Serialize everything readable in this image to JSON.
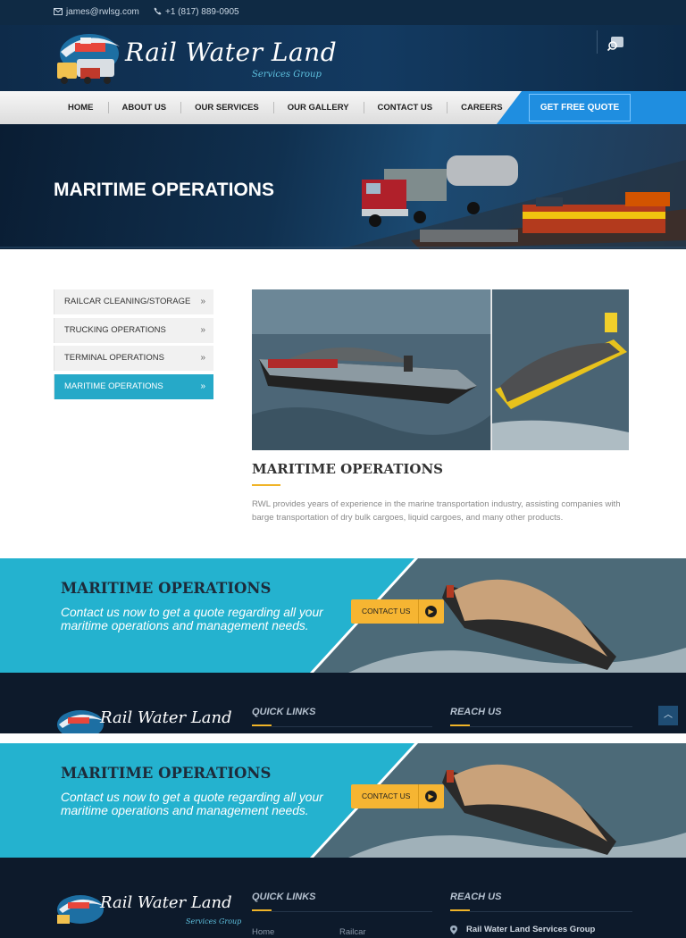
{
  "topbar": {
    "email": "james@rwlsg.com",
    "phone": "+1 (817) 889-0905"
  },
  "brand": {
    "name": "Rail Water Land",
    "tagline": "Services Group"
  },
  "nav": {
    "items": [
      "HOME",
      "ABOUT US",
      "OUR SERVICES",
      "OUR GALLERY",
      "CONTACT US",
      "CAREERS"
    ],
    "cta": "GET FREE QUOTE"
  },
  "banner": {
    "title": "MARITIME OPERATIONS"
  },
  "sidebar": {
    "items": [
      {
        "label": "RAILCAR CLEANING/STORAGE",
        "arrow": "»"
      },
      {
        "label": "TRUCKING OPERATIONS",
        "arrow": "»"
      },
      {
        "label": "TERMINAL OPERATIONS",
        "arrow": "»"
      },
      {
        "label": "MARITIME OPERATIONS",
        "arrow": "»",
        "active": true
      }
    ]
  },
  "content": {
    "title": "MARITIME OPERATIONS",
    "text": "RWL provides years of experience in the marine transportation industry, assisting companies with barge transportation of dry bulk cargoes, liquid cargoes, and many other products."
  },
  "cta": {
    "title": "MARITIME OPERATIONS",
    "subtitle": "Contact us now to get a quote regarding all your maritime operations and management needs.",
    "button": "CONTACT US"
  },
  "footer": {
    "quick_links_title": "QUICK LINKS",
    "reach_us_title": "REACH US",
    "links": [
      "Home",
      "Railcar"
    ],
    "address_name": "Rail Water Land Services Group"
  },
  "colors": {
    "accent": "#26a9c8",
    "quote_blue": "#1f8ee0",
    "gold": "#f0b428",
    "navy": "#0e2b4a"
  },
  "icons": [
    "envelope-icon",
    "phone-icon",
    "search-icon",
    "chevron-double-right-icon",
    "arrow-right-circle-icon",
    "chevron-up-icon",
    "map-pin-icon"
  ]
}
